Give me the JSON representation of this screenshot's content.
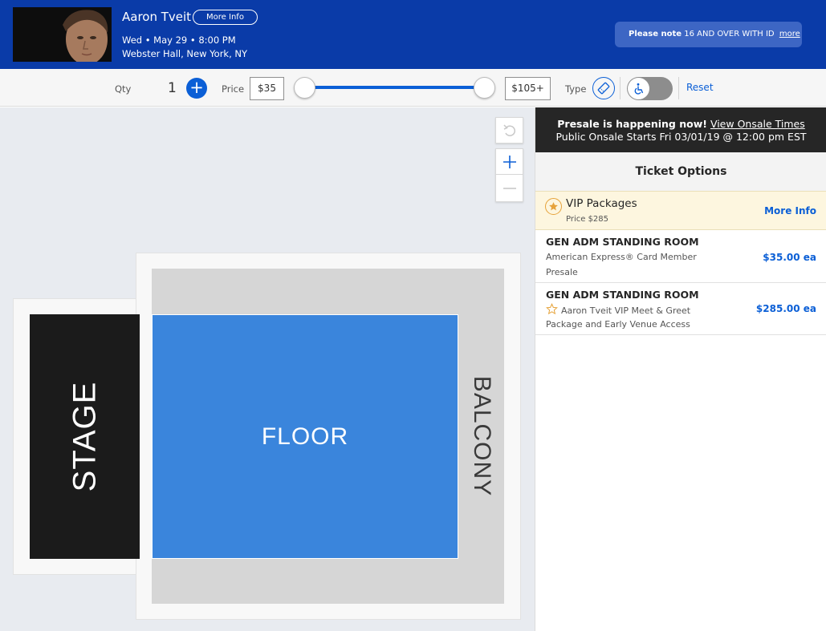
{
  "event": {
    "artist": "Aaron Tveit",
    "more_info_label": "More Info",
    "date": "Wed • May 29 • 8:00 PM",
    "venue": "Webster Hall, New York, NY"
  },
  "note": {
    "label": "Please note",
    "text": "16 AND OVER WITH ID",
    "link": "more"
  },
  "filters": {
    "qty_label": "Qty",
    "qty_value": "1",
    "price_label": "Price",
    "price_min": "$35",
    "price_max": "$105+",
    "type_label": "Type",
    "reset_label": "Reset",
    "accessible_toggle_on": false
  },
  "map": {
    "stage_label": "STAGE",
    "floor_label": "FLOOR",
    "balcony_label": "BALCONY"
  },
  "panel": {
    "presale_text": "Presale is happening now!",
    "presale_link": "View Onsale Times",
    "onsale_text": "Public Onsale Starts Fri 03/01/19 @ 12:00 pm EST",
    "ticket_options_title": "Ticket Options",
    "vip": {
      "title": "VIP Packages",
      "price": "Price $285",
      "more": "More Info"
    },
    "tickets": [
      {
        "title": "GEN ADM STANDING ROOM",
        "line1": "American Express® Card Member",
        "line2": "Presale",
        "price": "$35.00 ea"
      },
      {
        "title": "GEN ADM STANDING ROOM",
        "line1": "Aaron Tveit VIP Meet & Greet",
        "line2": "Package and Early Venue Access",
        "price": "$285.00 ea"
      }
    ]
  },
  "colors": {
    "header_bg": "#0a3ba8",
    "accent": "#0b5fd6",
    "floor": "#3a85dc",
    "stage": "#1b1b1b",
    "vip_bg": "#fdf6df"
  }
}
